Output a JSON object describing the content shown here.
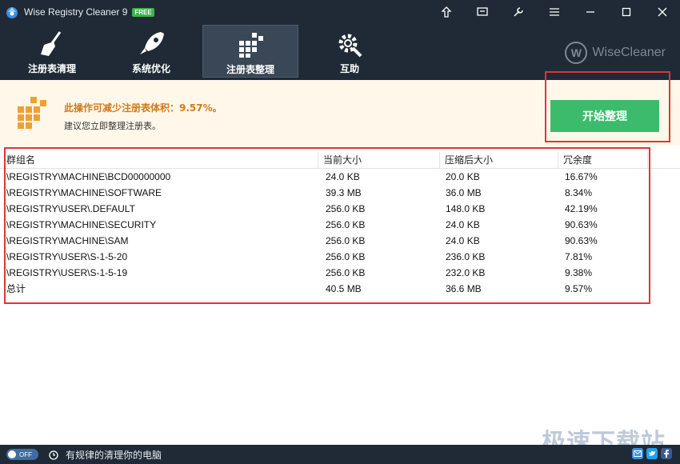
{
  "window": {
    "title": "Wise Registry Cleaner 9",
    "badge": "FREE"
  },
  "toolbar": {
    "tabs": [
      {
        "label": "注册表清理",
        "icon": "broom-icon"
      },
      {
        "label": "系统优化",
        "icon": "rocket-icon"
      },
      {
        "label": "注册表整理",
        "icon": "defrag-blocks-icon",
        "active": true
      },
      {
        "label": "互助",
        "icon": "gear-wrench-icon"
      }
    ],
    "brand": "WiseCleaner",
    "brand_letter": "W"
  },
  "info": {
    "title": "此操作可减少注册表体积：9.57%。",
    "subtitle": "建议您立即整理注册表。",
    "start_button": "开始整理"
  },
  "table": {
    "headers": [
      "群组名",
      "当前大小",
      "压缩后大小",
      "冗余度"
    ],
    "rows": [
      [
        "\\REGISTRY\\MACHINE\\BCD00000000",
        "24.0 KB",
        "20.0 KB",
        "16.67%"
      ],
      [
        "\\REGISTRY\\MACHINE\\SOFTWARE",
        "39.3 MB",
        "36.0 MB",
        "8.34%"
      ],
      [
        "\\REGISTRY\\USER\\.DEFAULT",
        "256.0 KB",
        "148.0 KB",
        "42.19%"
      ],
      [
        "\\REGISTRY\\MACHINE\\SECURITY",
        "256.0 KB",
        "24.0 KB",
        "90.63%"
      ],
      [
        "\\REGISTRY\\MACHINE\\SAM",
        "256.0 KB",
        "24.0 KB",
        "90.63%"
      ],
      [
        "\\REGISTRY\\USER\\S-1-5-20",
        "256.0 KB",
        "236.0 KB",
        "7.81%"
      ],
      [
        "\\REGISTRY\\USER\\S-1-5-19",
        "256.0 KB",
        "232.0 KB",
        "9.38%"
      ],
      [
        "总计",
        "40.5 MB",
        "36.6 MB",
        "9.57%"
      ]
    ]
  },
  "statusbar": {
    "toggle_label": "OFF",
    "text": "有规律的清理你的电脑"
  },
  "watermark": "极速下载站",
  "colors": {
    "titlebar_bg": "#1f2a36",
    "accent_green": "#3cbb6c",
    "info_title": "#d2791b",
    "highlight_red": "#e0343a"
  }
}
